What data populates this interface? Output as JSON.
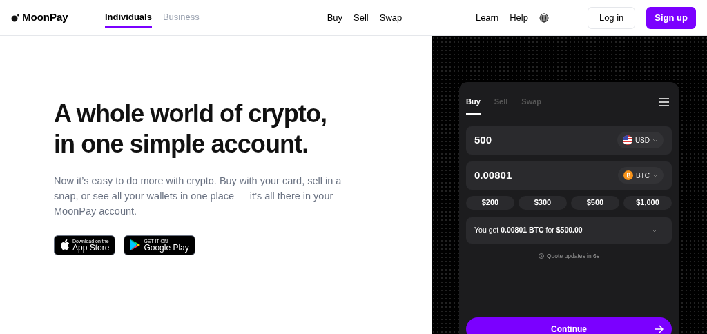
{
  "header": {
    "logo": "MoonPay",
    "segments": [
      {
        "label": "Individuals",
        "selected": true
      },
      {
        "label": "Business",
        "selected": false
      }
    ],
    "nav": [
      "Buy",
      "Sell",
      "Swap"
    ],
    "links": [
      "Learn",
      "Help"
    ],
    "login": "Log in",
    "signup": "Sign up"
  },
  "hero": {
    "title_lines": [
      "A whole world of crypto,",
      "in one simple account."
    ],
    "body": "Now it’s easy to do more with crypto. Buy with your card, sell in a snap, or see all your wallets in one place — it’s all there in your MoonPay account.",
    "stores": [
      {
        "kind": "apple",
        "small": "Download on the",
        "big": "App Store"
      },
      {
        "kind": "google",
        "small": "GET IT ON",
        "big": "Google Play"
      }
    ]
  },
  "widget": {
    "tabs": [
      {
        "label": "Buy",
        "selected": true
      },
      {
        "label": "Sell",
        "selected": false
      },
      {
        "label": "Swap",
        "selected": false
      }
    ],
    "amounts": [
      {
        "value": "500",
        "currency": "USD",
        "kind": "usd"
      },
      {
        "value": "0.00801",
        "currency": "BTC",
        "kind": "btc"
      }
    ],
    "presets": [
      "$200",
      "$300",
      "$500",
      "$1,000"
    ],
    "quote": "You get **0.00801 BTC** for **$500.00**",
    "timer": "Quote updates in 6s",
    "continue": "Continue"
  }
}
